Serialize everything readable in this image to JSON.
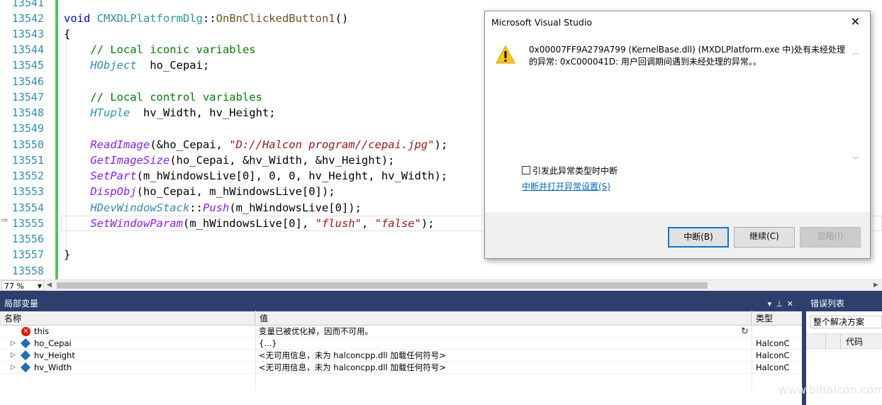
{
  "editor": {
    "line_numbers": [
      "13541",
      "13542",
      "13543",
      "13544",
      "13545",
      "13546",
      "13547",
      "13548",
      "13549",
      "13550",
      "13551",
      "13552",
      "13553",
      "13554",
      "13555",
      "13556",
      "13557",
      "13558"
    ],
    "code": {
      "l13542_kw": "void",
      "l13542_cls": "CMXDLPlatformDlg",
      "l13542_sep": "::",
      "l13542_fn": "OnBnClickedButton1",
      "l13542_paren": "()",
      "l13543": "{",
      "l13544": "// Local iconic variables",
      "l13545_type": "HObject",
      "l13545_rest": "  ho_Cepai;",
      "l13547": "// Local control variables",
      "l13548_type": "HTuple",
      "l13548_rest": "  hv_Width, hv_Height;",
      "l13550_fn": "ReadImage",
      "l13550_a": "(&ho_Cepai, ",
      "l13550_str": "\"D://Halcon program//cepai.jpg\"",
      "l13550_b": ");",
      "l13551_fn": "GetImageSize",
      "l13551_rest": "(ho_Cepai, &hv_Width, &hv_Height);",
      "l13552_fn": "SetPart",
      "l13552_rest": "(m_hWindowsLive[0], 0, 0, hv_Height, hv_Width);",
      "l13553_fn": "DispObj",
      "l13553_rest": "(ho_Cepai, m_hWindowsLive[0]);",
      "l13554_cls": "HDevWindowStack",
      "l13554_sep": "::",
      "l13554_fn": "Push",
      "l13554_rest": "(m_hWindowsLive[0]);",
      "l13555_fn": "SetWindowParam",
      "l13555_a": "(m_hWindowsLive[0], ",
      "l13555_s1": "\"flush\"",
      "l13555_c": ", ",
      "l13555_s2": "\"false\"",
      "l13555_b": ");",
      "l13557": "}"
    },
    "zoom_level": "77 %"
  },
  "locals_panel": {
    "title": "局部变量",
    "col_name": "名称",
    "col_value": "值",
    "col_type": "类型",
    "rows": [
      {
        "name": "this",
        "value": "变量已被优化掉，因而不可用。",
        "type": "",
        "icon": "error-icon"
      },
      {
        "name": "ho_Cepai",
        "value": "{...}",
        "type": "HalconC",
        "icon": "variable-icon"
      },
      {
        "name": "hv_Height",
        "value": "<无可用信息，未为 halconcpp.dll 加载任何符号>",
        "type": "HalconC",
        "icon": "variable-icon"
      },
      {
        "name": "hv_Width",
        "value": "<无可用信息，未为 halconcpp.dll 加载任何符号>",
        "type": "HalconC",
        "icon": "variable-icon"
      }
    ]
  },
  "error_panel": {
    "title": "错误列表",
    "scope": "整个解决方案",
    "col_code": "代码"
  },
  "watermark": "www.bihalcon.com",
  "dialog": {
    "title": "Microsoft Visual Studio",
    "message": "0x00007FF9A279A799 (KernelBase.dll) (MXDLPlatform.exe 中)处有未经处理的异常: 0xC000041D: 用户回调期间遇到未经处理的异常。。",
    "checkbox_label": "引发此异常类型时中断",
    "link_text": "中断并打开异常设置(S)",
    "btn_break": "中断(B)",
    "btn_continue": "继续(C)",
    "btn_ignore": "忽略(I)"
  },
  "colors": {
    "accent": "#0078d7",
    "panel_header": "#2d3f6e",
    "change_bar": "#57c35a",
    "link": "#0066cc"
  }
}
